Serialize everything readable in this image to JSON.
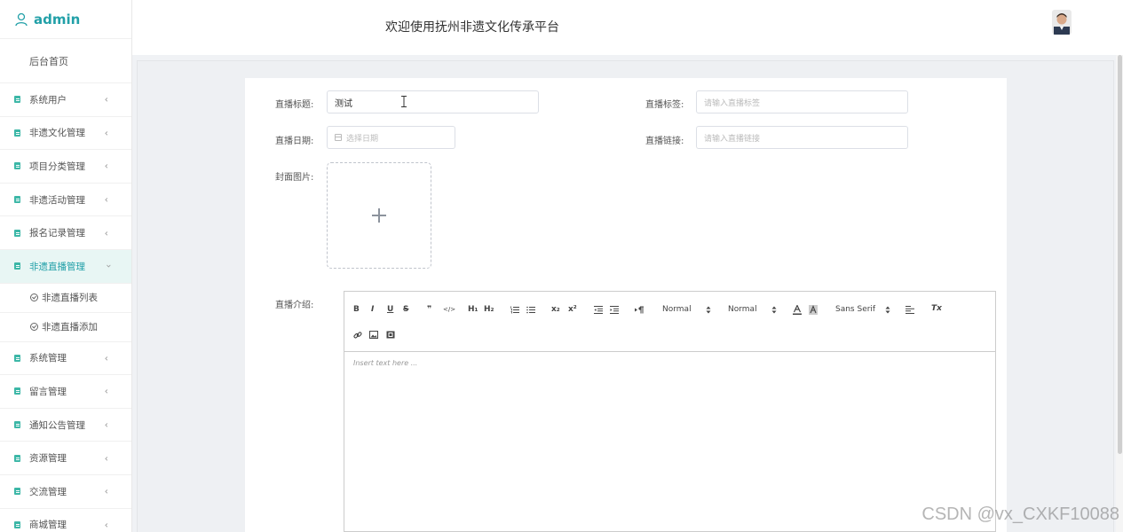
{
  "brand": {
    "name": "admin"
  },
  "header": {
    "title": "欢迎使用抚州非遗文化传承平台"
  },
  "sidebar": {
    "home": "后台首页",
    "items": [
      {
        "label": "系统用户"
      },
      {
        "label": "非遗文化管理"
      },
      {
        "label": "项目分类管理"
      },
      {
        "label": "非遗活动管理"
      },
      {
        "label": "报名记录管理"
      },
      {
        "label": "非遗直播管理",
        "active": true
      },
      {
        "label": "系统管理"
      },
      {
        "label": "留言管理"
      },
      {
        "label": "通知公告管理"
      },
      {
        "label": "资源管理"
      },
      {
        "label": "交流管理"
      },
      {
        "label": "商城管理"
      }
    ],
    "subitems": [
      "非遗直播列表",
      "非遗直播添加"
    ]
  },
  "form": {
    "title_label": "直播标题:",
    "title_value": "测试",
    "tag_label": "直播标签:",
    "tag_placeholder": "请输入直播标签",
    "date_label": "直播日期:",
    "date_placeholder": "选择日期",
    "link_label": "直播链接:",
    "link_placeholder": "请输入直播链接",
    "cover_label": "封面图片:",
    "intro_label": "直播介绍:"
  },
  "editor": {
    "toolbar": {
      "bold": "B",
      "italic": "I",
      "underline": "U",
      "strike": "S",
      "quote": "❞",
      "code": "</>",
      "h1": "H₁",
      "h2": "H₂",
      "sub": "x₂",
      "sup": "x²",
      "header_select": "Normal",
      "size_select": "Normal",
      "font_select": "Sans Serif",
      "clean": "Tx"
    },
    "placeholder": "Insert text here ..."
  },
  "watermark": "CSDN @vx_CXKF10088",
  "colors": {
    "accent": "#22a0a8",
    "menu_icon": "#3cb7a7",
    "active_bg": "#e8f6f4"
  }
}
